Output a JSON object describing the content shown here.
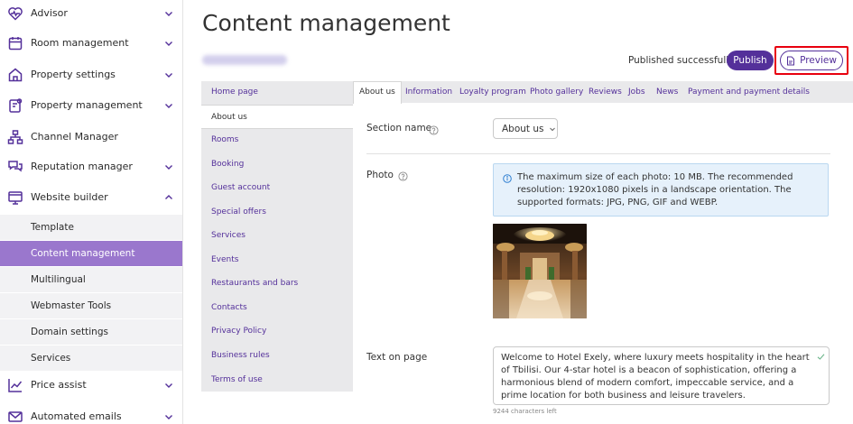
{
  "sidebar": {
    "items": [
      {
        "label": "Advisor",
        "icon": "heart-pulse-icon",
        "expanded": false
      },
      {
        "label": "Room management",
        "icon": "calendar-icon",
        "expanded": false
      },
      {
        "label": "Property settings",
        "icon": "house-icon",
        "expanded": false
      },
      {
        "label": "Property management",
        "icon": "clipboard-gear-icon",
        "expanded": false
      },
      {
        "label": "Channel Manager",
        "icon": "sitemap-icon"
      },
      {
        "label": "Reputation manager",
        "icon": "chat-bubbles-icon",
        "expanded": false
      },
      {
        "label": "Website builder",
        "icon": "monitor-icon",
        "expanded": true
      },
      {
        "label": "Price assist",
        "icon": "chart-line-icon",
        "expanded": false
      },
      {
        "label": "Automated emails",
        "icon": "envelope-icon",
        "expanded": false
      }
    ],
    "website_builder_sub": [
      {
        "label": "Template",
        "active": false
      },
      {
        "label": "Content management",
        "active": true
      },
      {
        "label": "Multilingual",
        "active": false
      },
      {
        "label": "Webmaster Tools",
        "active": false
      },
      {
        "label": "Domain settings",
        "active": false
      },
      {
        "label": "Services",
        "active": false
      }
    ]
  },
  "header": {
    "title": "Content management",
    "publish_status": "Published successfully",
    "publish_label": "Publish",
    "preview_label": "Preview"
  },
  "pages": [
    {
      "label": "Home page",
      "active": false
    },
    {
      "label": "About us",
      "active": true
    },
    {
      "label": "Rooms",
      "active": false
    },
    {
      "label": "Booking",
      "active": false
    },
    {
      "label": "Guest account",
      "active": false
    },
    {
      "label": "Special offers",
      "active": false
    },
    {
      "label": "Services",
      "active": false
    },
    {
      "label": "Events",
      "active": false
    },
    {
      "label": "Restaurants and bars",
      "active": false
    },
    {
      "label": "Contacts",
      "active": false
    },
    {
      "label": "Privacy Policy",
      "active": false
    },
    {
      "label": "Business rules",
      "active": false
    },
    {
      "label": "Terms of use",
      "active": false
    }
  ],
  "tabs": [
    {
      "label": "About us",
      "active": true
    },
    {
      "label": "Information",
      "active": false
    },
    {
      "label": "Loyalty program",
      "active": false
    },
    {
      "label": "Photo gallery",
      "active": false
    },
    {
      "label": "Reviews",
      "active": false
    },
    {
      "label": "Jobs",
      "active": false
    },
    {
      "label": "News",
      "active": false
    },
    {
      "label": "Payment and payment details",
      "active": false
    }
  ],
  "form": {
    "section_name_label": "Section name",
    "section_name_value": "About us",
    "photo_label": "Photo",
    "photo_info": "The maximum size of each photo: 10 MB. The recommended resolution: 1920x1080 pixels in a landscape orientation. The supported formats: JPG, PNG, GIF and WEBP.",
    "text_label": "Text on page",
    "text_value": "Welcome to Hotel Exely, where luxury meets hospitality in the heart of Tbilisi. Our 4-star hotel is a beacon of sophistication, offering a harmonious blend of modern comfort, impeccable service, and a prime location for both business and leisure travelers.",
    "chars_left": "9244 characters left"
  },
  "colors": {
    "brand": "#54309a",
    "active_sub": "#9a77cd",
    "highlight": "#e8000e",
    "info_bg": "#e6f1fb"
  }
}
